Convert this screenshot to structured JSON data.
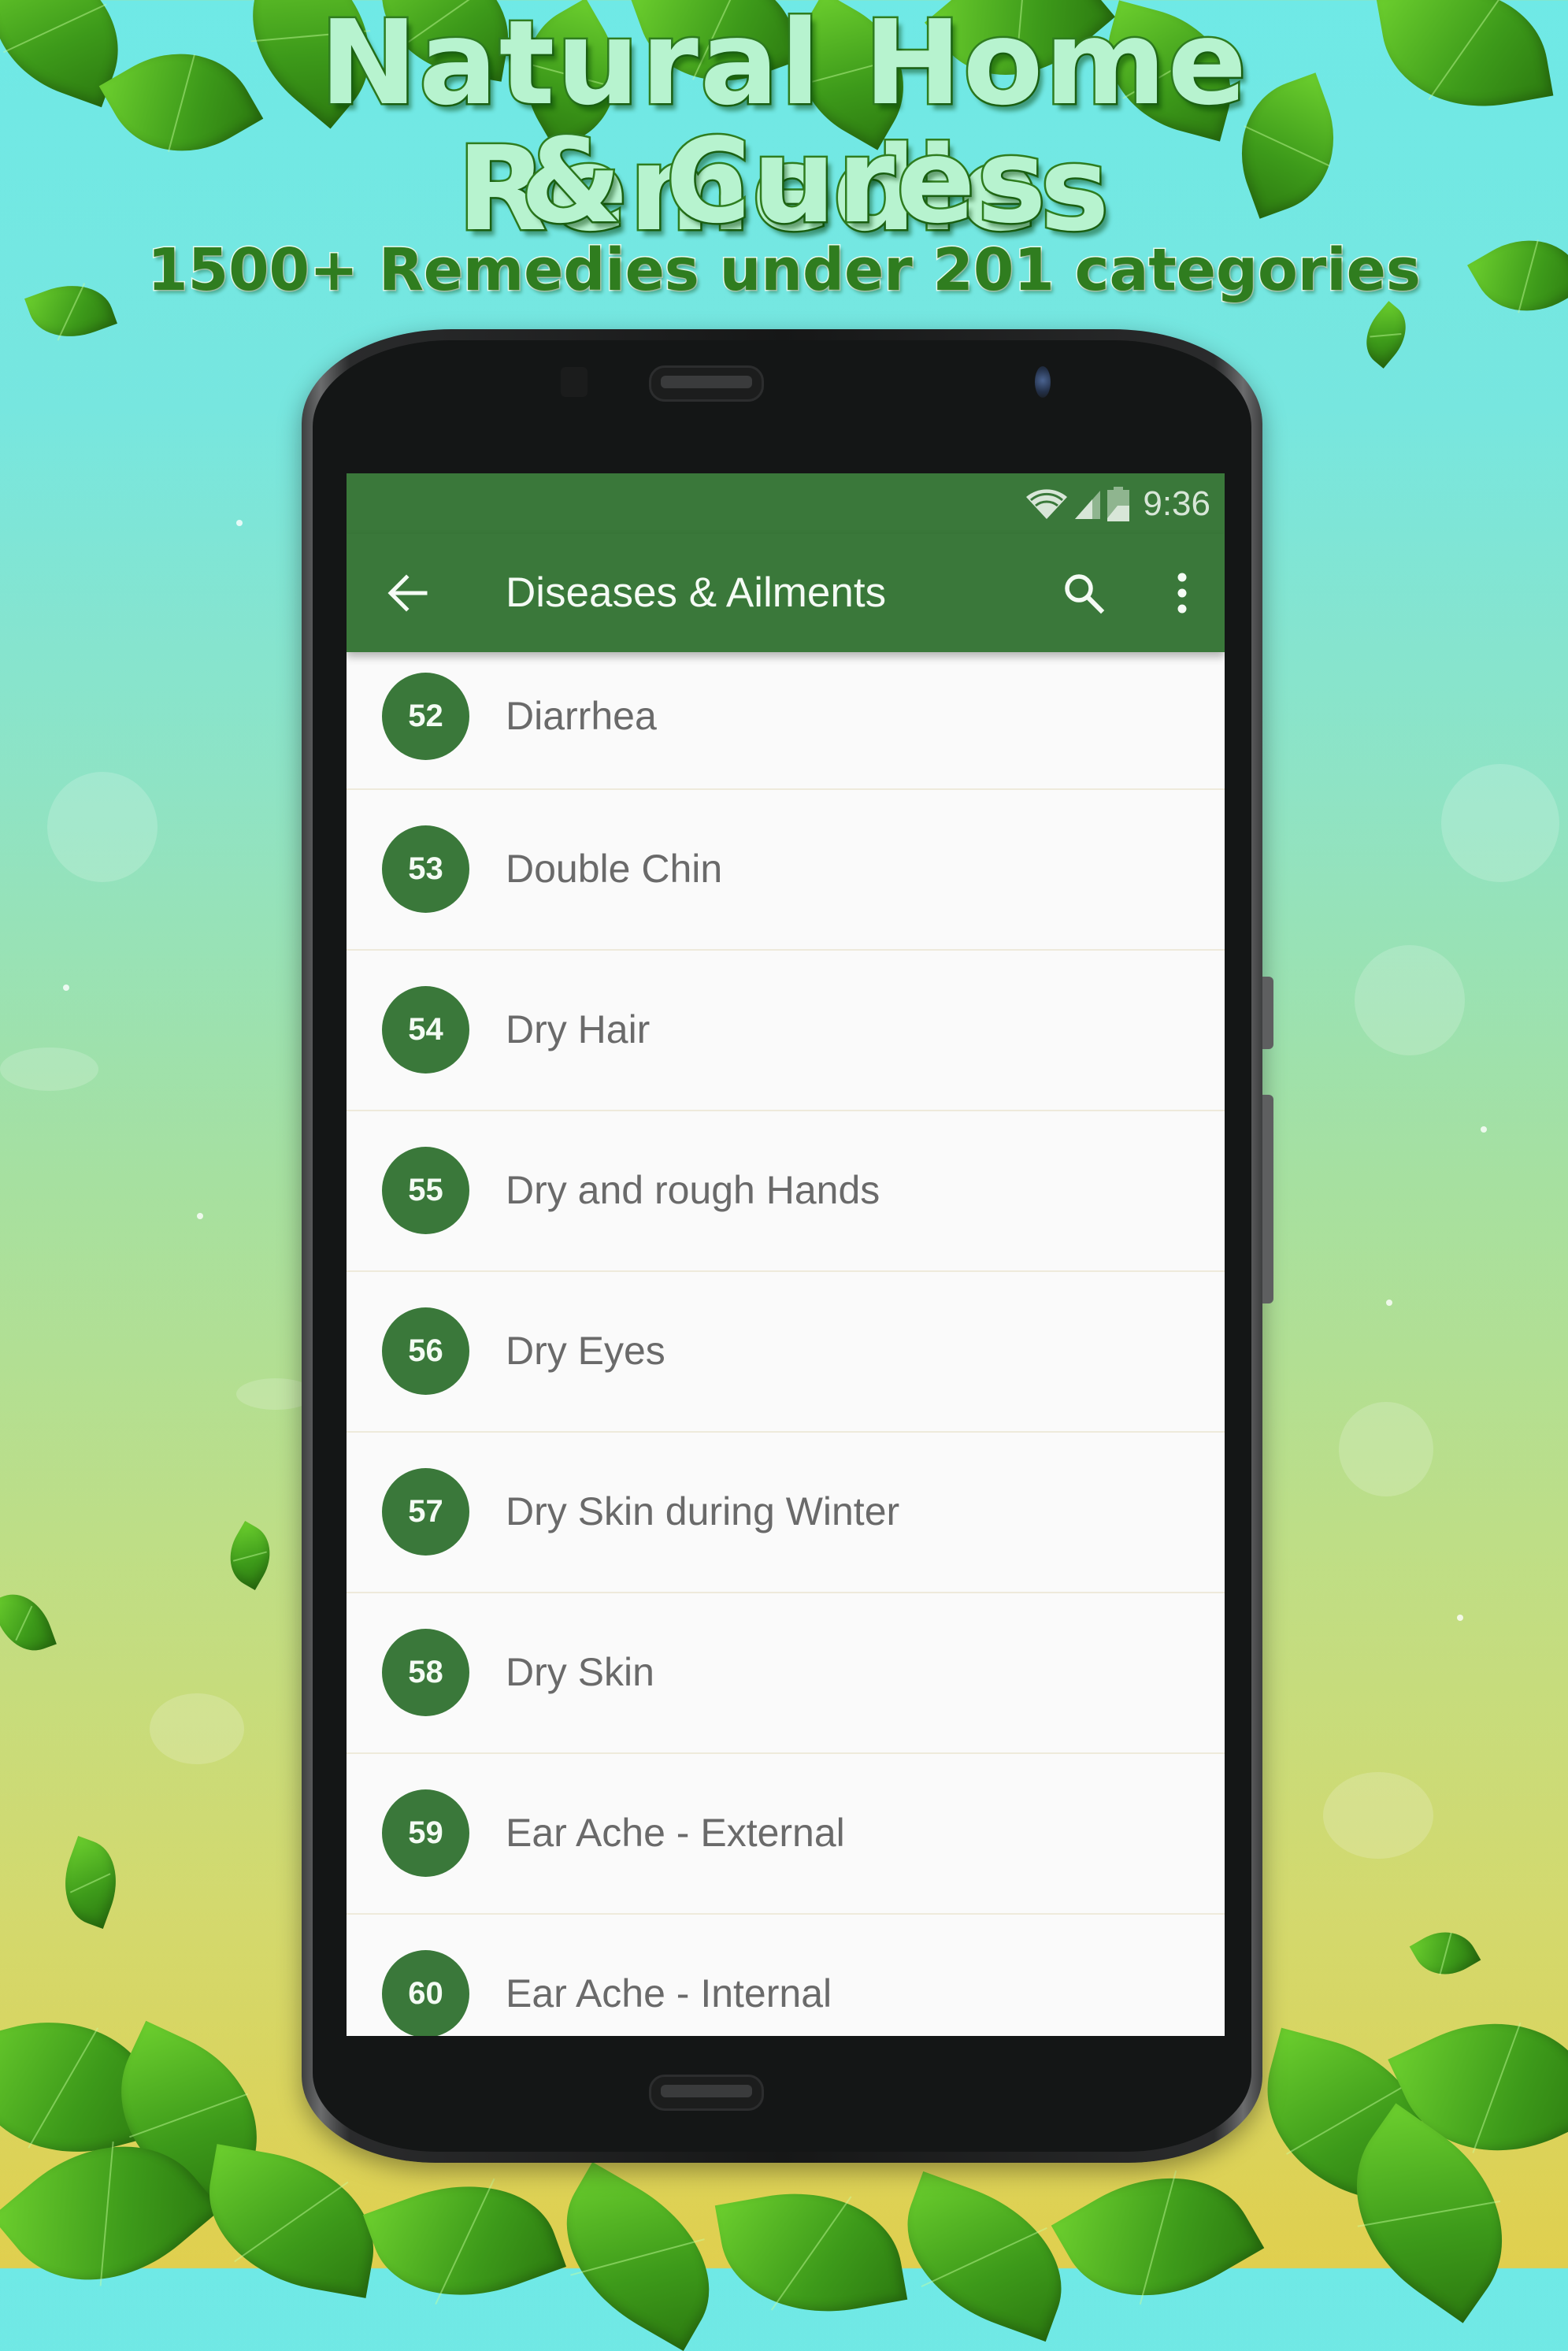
{
  "promo": {
    "title_line1": "Natural Home Remedies",
    "title_line2": "& Cures",
    "subtitle": "1500+ Remedies under 201 categories"
  },
  "status_bar": {
    "time": "9:36",
    "icons": [
      "wifi-icon",
      "cell-signal-icon",
      "battery-charging-icon"
    ]
  },
  "toolbar": {
    "back_icon": "arrow-left",
    "title": "Diseases & Ailments",
    "search_icon": "search",
    "more_icon": "more-vertical"
  },
  "colors": {
    "primary": "#3a783a",
    "list_bg": "#fafafa",
    "item_text": "#6a6a6a",
    "divider": "#eeeadb"
  },
  "list": {
    "items": [
      {
        "number": "52",
        "label": "Diarrhea"
      },
      {
        "number": "53",
        "label": "Double Chin"
      },
      {
        "number": "54",
        "label": "Dry Hair"
      },
      {
        "number": "55",
        "label": "Dry and rough Hands"
      },
      {
        "number": "56",
        "label": "Dry Eyes"
      },
      {
        "number": "57",
        "label": "Dry Skin during Winter"
      },
      {
        "number": "58",
        "label": "Dry Skin"
      },
      {
        "number": "59",
        "label": "Ear Ache - External"
      },
      {
        "number": "60",
        "label": "Ear Ache - Internal"
      }
    ]
  }
}
